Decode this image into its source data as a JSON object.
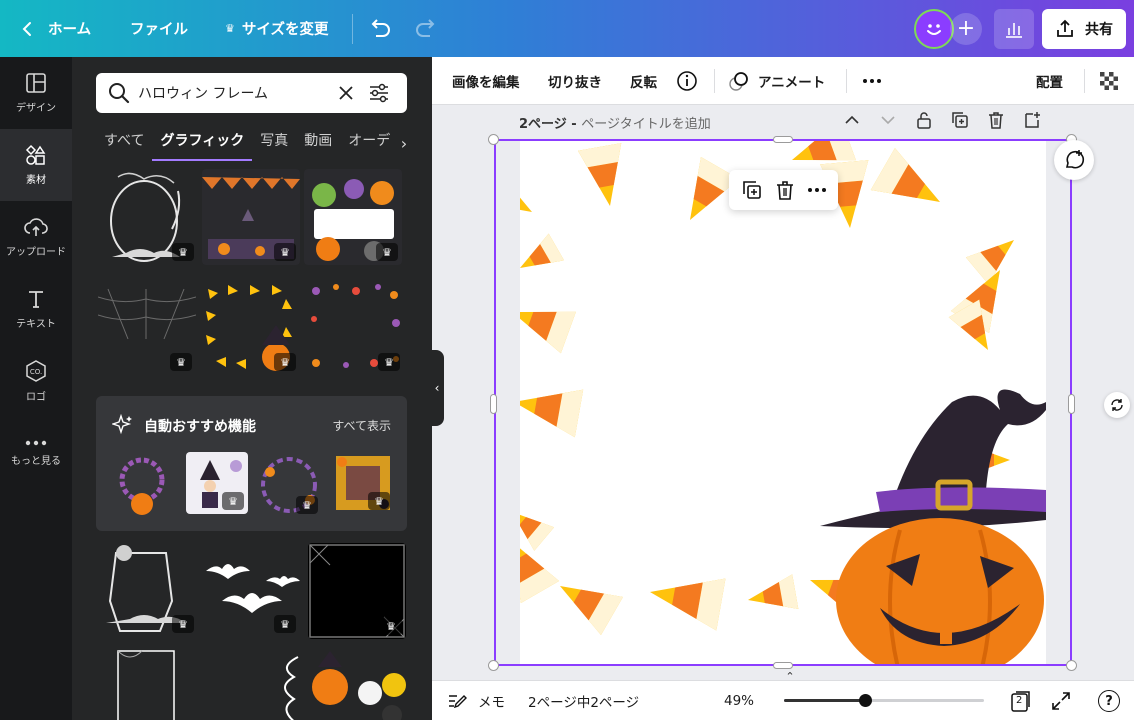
{
  "topbar": {
    "home_label": "ホーム",
    "file_label": "ファイル",
    "resize_label": "サイズを変更",
    "share_label": "共有"
  },
  "rail": {
    "items": [
      {
        "label": "デザイン",
        "icon": "layout-icon"
      },
      {
        "label": "素材",
        "icon": "elements-icon"
      },
      {
        "label": "アップロード",
        "icon": "upload-cloud-icon"
      },
      {
        "label": "テキスト",
        "icon": "text-icon"
      },
      {
        "label": "ロゴ",
        "icon": "logo-icon"
      },
      {
        "label": "もっと見る",
        "icon": "more-dots-icon"
      }
    ]
  },
  "panel": {
    "search_value": "ハロウィン フレーム",
    "tabs": [
      "すべて",
      "グラフィック",
      "写真",
      "動画",
      "オーデ"
    ],
    "reco_title": "自動おすすめ機能",
    "reco_see_all": "すべて表示"
  },
  "toolbar": {
    "edit_image": "画像を編集",
    "crop": "切り抜き",
    "flip": "反転",
    "animate": "アニメート",
    "arrange": "配置"
  },
  "page_header": {
    "page_label": "2ページ - ",
    "title_placeholder": "ページタイトルを追加"
  },
  "bottombar": {
    "notes": "メモ",
    "page_count": "2ページ中2ページ",
    "zoom": "49%",
    "zoom_fraction": 0.49,
    "pages_badge": "2",
    "help": "?"
  },
  "colors": {
    "accent": "#8b3dff",
    "panel_bg": "#252627",
    "rail_bg": "#18191b",
    "candy_yellow": "#ffc20e",
    "candy_orange": "#f47a20",
    "pumpkin": "#f07d14",
    "hat": "#2b2330",
    "hat_band": "#7b3fb5"
  }
}
